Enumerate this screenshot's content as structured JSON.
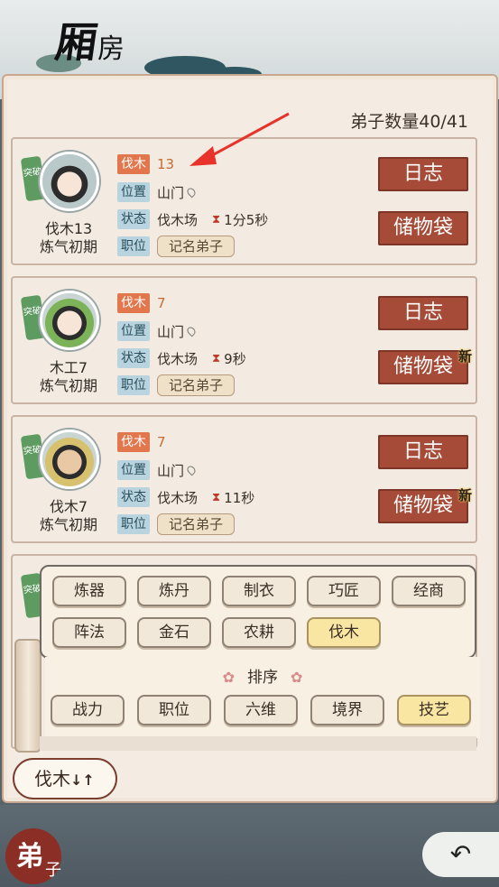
{
  "header": {
    "title_big": "厢",
    "title_small": "房"
  },
  "count": {
    "label": "弟子数量",
    "value": "40/41"
  },
  "labels": {
    "skill": "伐木",
    "location": "位置",
    "status": "状态",
    "post": "职位",
    "breakthrough": "突破",
    "log": "日志",
    "bag": "储物袋",
    "new": "新"
  },
  "disciples": [
    {
      "name": "伐木13",
      "realm": "炼气初期",
      "skill_level": "13",
      "location": "山门",
      "status": "伐木场",
      "time": "1分5秒",
      "post": "记名弟子",
      "bag_new": false
    },
    {
      "name": "木工7",
      "realm": "炼气初期",
      "skill_level": "7",
      "location": "山门",
      "status": "伐木场",
      "time": "9秒",
      "post": "记名弟子",
      "bag_new": true
    },
    {
      "name": "伐木7",
      "realm": "炼气初期",
      "skill_level": "7",
      "location": "山门",
      "status": "伐木场",
      "time": "11秒",
      "post": "记名弟子",
      "bag_new": true
    }
  ],
  "filters": [
    "炼器",
    "炼丹",
    "制衣",
    "巧匠",
    "经商",
    "阵法",
    "金石",
    "农耕",
    "伐木"
  ],
  "selected_filter": "伐木",
  "sort": {
    "title": "排序",
    "options": [
      "战力",
      "职位",
      "六维",
      "境界",
      "技艺"
    ],
    "selected": "技艺"
  },
  "sort_select": {
    "label": "伐木",
    "icon": "↓↑"
  },
  "nav": {
    "disciple_big": "弟",
    "disciple_small": "子",
    "back_icon": "↶"
  },
  "colors": {
    "accent_button": "#a64b37",
    "skill_tag": "#e2764d",
    "info_tag": "#b9d4df",
    "selected_chip": "#f9e6a3",
    "arrow": "#e8332a"
  }
}
